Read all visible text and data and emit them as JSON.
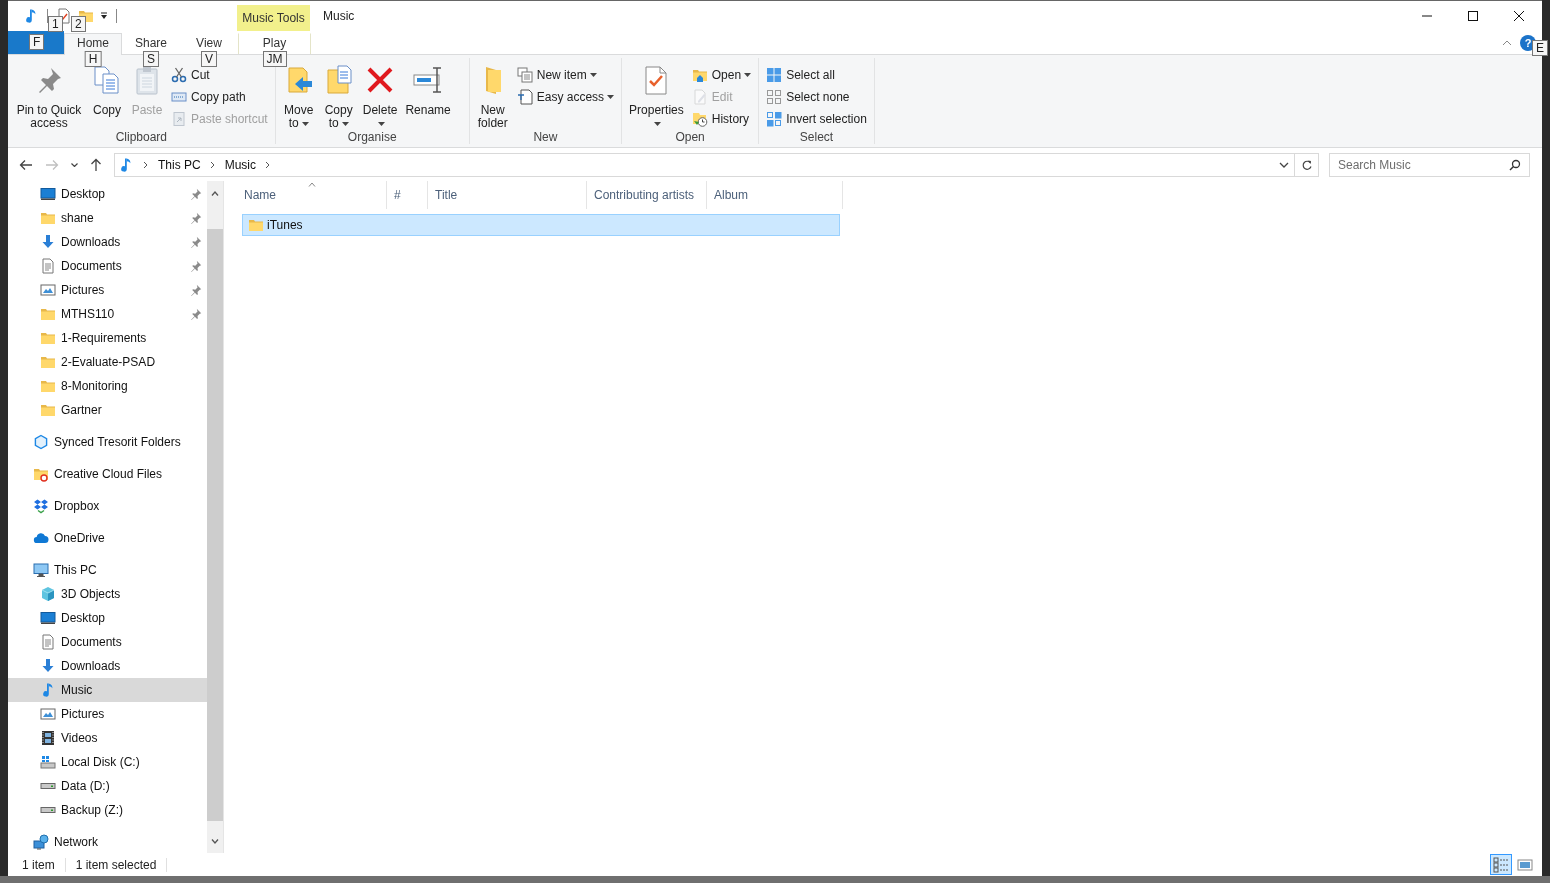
{
  "window": {
    "title": "Music"
  },
  "quick_access": {
    "keytips": [
      "1",
      "2"
    ]
  },
  "context_tab_group": {
    "label": "Music Tools"
  },
  "file_tab": {
    "keytip": "F"
  },
  "tabs": [
    {
      "label": "Home",
      "keytip": "H",
      "selected": true
    },
    {
      "label": "Share",
      "keytip": "S",
      "selected": false
    },
    {
      "label": "View",
      "keytip": "V",
      "selected": false
    },
    {
      "label": "Play",
      "keytip": "JM",
      "selected": false
    }
  ],
  "help": {
    "label": "?",
    "keytip": "E"
  },
  "ribbon": {
    "groups": [
      {
        "label": "Clipboard",
        "buttons": [
          {
            "kind": "large",
            "label": "Pin to Quick access",
            "disabled": false,
            "dropdown": false
          },
          {
            "kind": "large",
            "label": "Copy",
            "disabled": false,
            "dropdown": false
          },
          {
            "kind": "large",
            "label": "Paste",
            "disabled": true,
            "dropdown": false
          },
          {
            "kind": "small",
            "label": "Cut",
            "disabled": false,
            "dropdown": false
          },
          {
            "kind": "small",
            "label": "Copy path",
            "disabled": false,
            "dropdown": false
          },
          {
            "kind": "small",
            "label": "Paste shortcut",
            "disabled": true,
            "dropdown": false
          }
        ]
      },
      {
        "label": "Organise",
        "buttons": [
          {
            "kind": "large",
            "label": "Move to",
            "disabled": false,
            "dropdown": true
          },
          {
            "kind": "large",
            "label": "Copy to",
            "disabled": false,
            "dropdown": true
          },
          {
            "kind": "large",
            "label": "Delete",
            "disabled": false,
            "dropdown": true
          },
          {
            "kind": "large",
            "label": "Rename",
            "disabled": false,
            "dropdown": false
          }
        ]
      },
      {
        "label": "New",
        "buttons": [
          {
            "kind": "large",
            "label": "New folder",
            "disabled": false,
            "dropdown": false
          },
          {
            "kind": "small",
            "label": "New item",
            "disabled": false,
            "dropdown": true
          },
          {
            "kind": "small",
            "label": "Easy access",
            "disabled": false,
            "dropdown": true
          }
        ]
      },
      {
        "label": "Open",
        "buttons": [
          {
            "kind": "large",
            "label": "Properties",
            "disabled": false,
            "dropdown": true
          },
          {
            "kind": "small",
            "label": "Open",
            "disabled": false,
            "dropdown": true
          },
          {
            "kind": "small",
            "label": "Edit",
            "disabled": true,
            "dropdown": false
          },
          {
            "kind": "small",
            "label": "History",
            "disabled": false,
            "dropdown": false
          }
        ]
      },
      {
        "label": "Select",
        "buttons": [
          {
            "kind": "small",
            "label": "Select all",
            "disabled": false,
            "dropdown": false
          },
          {
            "kind": "small",
            "label": "Select none",
            "disabled": false,
            "dropdown": false
          },
          {
            "kind": "small",
            "label": "Invert selection",
            "disabled": false,
            "dropdown": false
          }
        ]
      }
    ]
  },
  "address_bar": {
    "nav": [
      {
        "kind": "back",
        "disabled": false
      },
      {
        "kind": "forward",
        "disabled": true
      },
      {
        "kind": "recent",
        "disabled": false
      },
      {
        "kind": "up",
        "disabled": false
      }
    ],
    "breadcrumbs": [
      "This PC",
      "Music"
    ]
  },
  "search": {
    "placeholder": "Search Music"
  },
  "nav_pane": {
    "quick_access_items": [
      {
        "label": "Desktop",
        "pinned": true,
        "selected": false
      },
      {
        "label": "shane",
        "pinned": true,
        "selected": false
      },
      {
        "label": "Downloads",
        "pinned": true,
        "selected": false
      },
      {
        "label": "Documents",
        "pinned": true,
        "selected": false
      },
      {
        "label": "Pictures",
        "pinned": true,
        "selected": false
      },
      {
        "label": "MTHS110",
        "pinned": true,
        "selected": false
      },
      {
        "label": "1-Requirements",
        "pinned": false,
        "selected": false
      },
      {
        "label": "2-Evaluate-PSAD",
        "pinned": false,
        "selected": false
      },
      {
        "label": "8-Monitoring",
        "pinned": false,
        "selected": false
      },
      {
        "label": "Gartner",
        "pinned": false,
        "selected": false
      }
    ],
    "items": [
      {
        "label": "Synced Tresorit Folders",
        "selected": false
      },
      {
        "label": "Creative Cloud Files",
        "selected": false
      },
      {
        "label": "Dropbox",
        "selected": false
      },
      {
        "label": "OneDrive",
        "selected": false
      },
      {
        "label": "This PC",
        "selected": false,
        "children": [
          {
            "label": "3D Objects",
            "selected": false
          },
          {
            "label": "Desktop",
            "selected": false
          },
          {
            "label": "Documents",
            "selected": false
          },
          {
            "label": "Downloads",
            "selected": false
          },
          {
            "label": "Music",
            "selected": true
          },
          {
            "label": "Pictures",
            "selected": false
          },
          {
            "label": "Videos",
            "selected": false
          },
          {
            "label": "Local Disk (C:)",
            "selected": false
          },
          {
            "label": "Data (D:)",
            "selected": false
          },
          {
            "label": "Backup (Z:)",
            "selected": false
          }
        ]
      },
      {
        "label": "Network",
        "selected": false
      }
    ]
  },
  "file_list": {
    "columns": [
      {
        "label": "Name",
        "sorted": true
      },
      {
        "label": "#",
        "sorted": false
      },
      {
        "label": "Title",
        "sorted": false
      },
      {
        "label": "Contributing artists",
        "sorted": false
      },
      {
        "label": "Album",
        "sorted": false
      }
    ],
    "rows": [
      {
        "cells": [
          "iTunes"
        ],
        "selected": true
      }
    ]
  },
  "status_bar": {
    "texts": [
      "1 item",
      "1 item selected"
    ],
    "views": [
      {
        "selected": true
      },
      {
        "selected": false
      }
    ]
  }
}
